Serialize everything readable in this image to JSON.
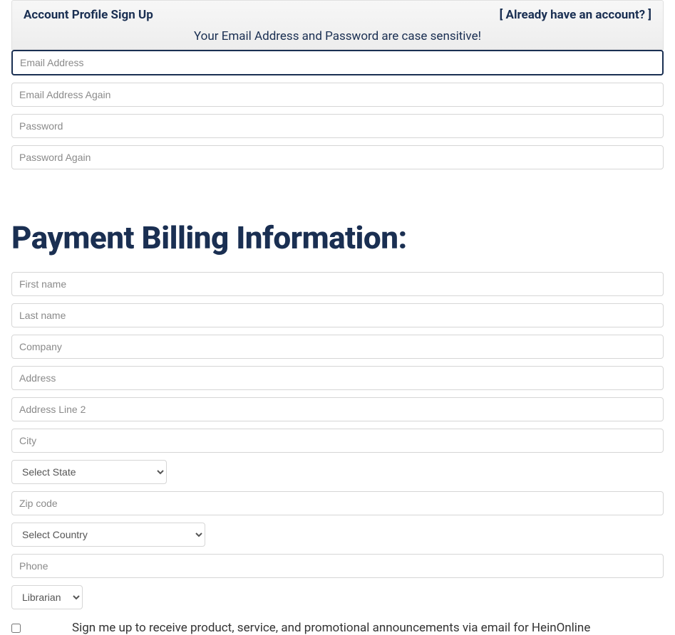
{
  "header": {
    "title": "Account Profile Sign Up",
    "already_link": "[ Already have an account? ]",
    "note": "Your Email Address and Password are case sensitive!"
  },
  "account": {
    "email_placeholder": "Email Address",
    "email_again_placeholder": "Email Address Again",
    "password_placeholder": "Password",
    "password_again_placeholder": "Password Again"
  },
  "billing": {
    "heading": "Payment Billing Information:",
    "first_name_placeholder": "First name",
    "last_name_placeholder": "Last name",
    "company_placeholder": "Company",
    "address_placeholder": "Address",
    "address2_placeholder": "Address Line 2",
    "city_placeholder": "City",
    "state_option": "Select State",
    "zip_placeholder": "Zip code",
    "country_option": "Select Country",
    "phone_placeholder": "Phone",
    "role_option": "Librarian",
    "optin_label": "Sign me up to receive product, service, and promotional announcements via email for HeinOnline"
  }
}
